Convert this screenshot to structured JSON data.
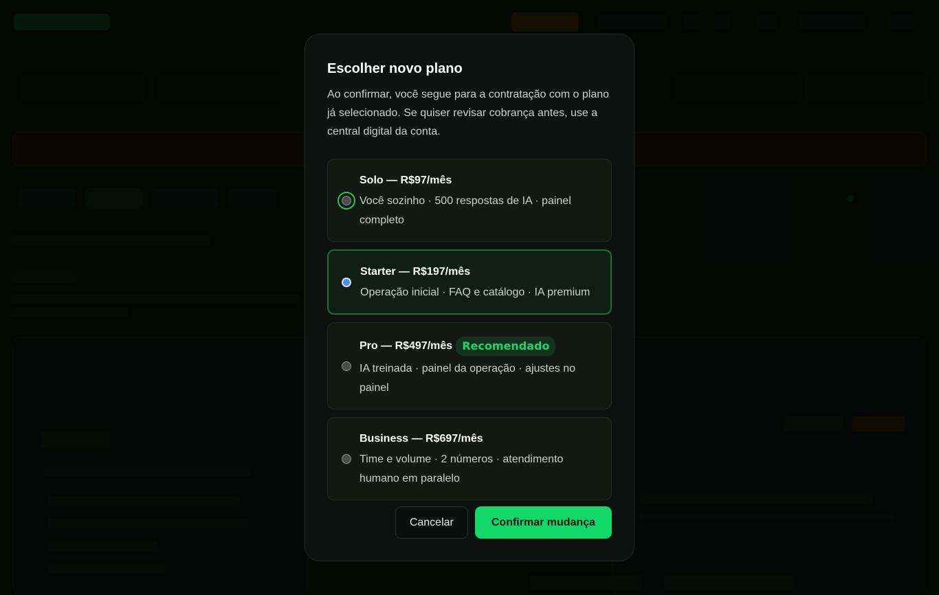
{
  "modal": {
    "title": "Escolher novo plano",
    "description": "Ao confirmar, você segue para a contratação com o plano já selecionado. Se quiser revisar cobrança antes, use a central digital da conta.",
    "plans": [
      {
        "name": "Solo — R$97/mês",
        "badge": "",
        "description": "Você sozinho · 500 respostas de IA · painel completo",
        "selected": false
      },
      {
        "name": "Starter — R$197/mês",
        "badge": "",
        "description": "Operação inicial · FAQ e catálogo · IA premium",
        "selected": true
      },
      {
        "name": "Pro — R$497/mês",
        "badge": "Recomendado",
        "description": "IA treinada · painel da operação · ajustes no painel",
        "selected": false
      },
      {
        "name": "Business — R$697/mês",
        "badge": "",
        "description": "Time e volume · 2 números · atendimento humano em paralelo",
        "selected": false
      }
    ],
    "cancel_label": "Cancelar",
    "confirm_label": "Confirmar mudança"
  },
  "colors": {
    "accent": "#10d96a",
    "badge_text": "#22d46b",
    "selected_radio": "#4d8ff0",
    "selected_border": "#1e6b3e"
  }
}
